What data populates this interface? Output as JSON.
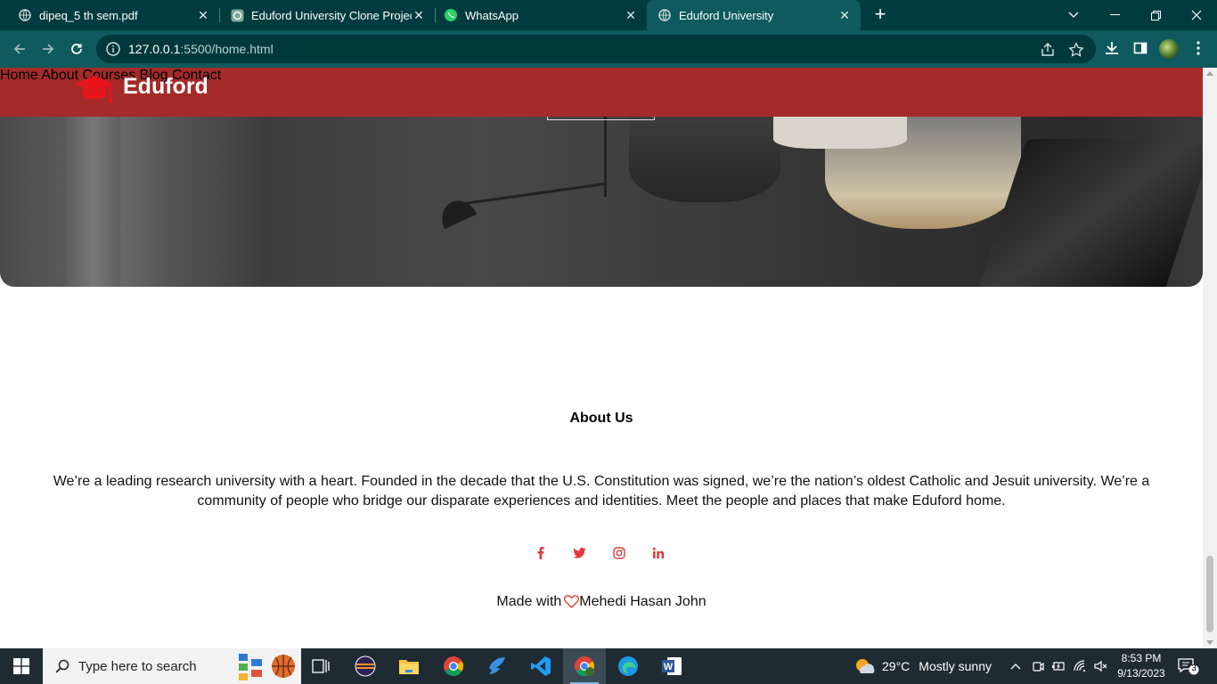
{
  "browser": {
    "tabs": [
      {
        "title": "dipeq_5 th sem.pdf",
        "active": false
      },
      {
        "title": "Eduford University Clone Project",
        "active": false
      },
      {
        "title": "WhatsApp",
        "active": false
      },
      {
        "title": "Eduford University",
        "active": true
      }
    ],
    "new_tab": "+",
    "url_host": "127.0.0.1",
    "url_rest": ":5500/home.html"
  },
  "site": {
    "brand": "Eduford",
    "nav": [
      "Home",
      "About",
      "Courses",
      "Blog",
      "Contact"
    ],
    "about_title": "About Us",
    "about_text": "We’re a leading research university with a heart. Founded in the decade that the U.S. Constitution was signed, we’re the nation’s oldest Catholic and Jesuit university. We’re a community of people who bridge our disparate experiences and identities. Meet the people and places that make Eduford home.",
    "social_icons": [
      "facebook-icon",
      "twitter-icon",
      "instagram-icon",
      "linkedin-icon"
    ],
    "made_with_prefix": "Made with",
    "made_with_author": "Mehedi Hasan John",
    "accent": "#a52a2a",
    "social_color": "#e23b3b"
  },
  "taskbar": {
    "search_placeholder": "Type here to search",
    "weather_temp": "29°C",
    "weather_text": "Mostly sunny",
    "time": "8:53 PM",
    "date": "9/13/2023",
    "notification_count": "3"
  }
}
